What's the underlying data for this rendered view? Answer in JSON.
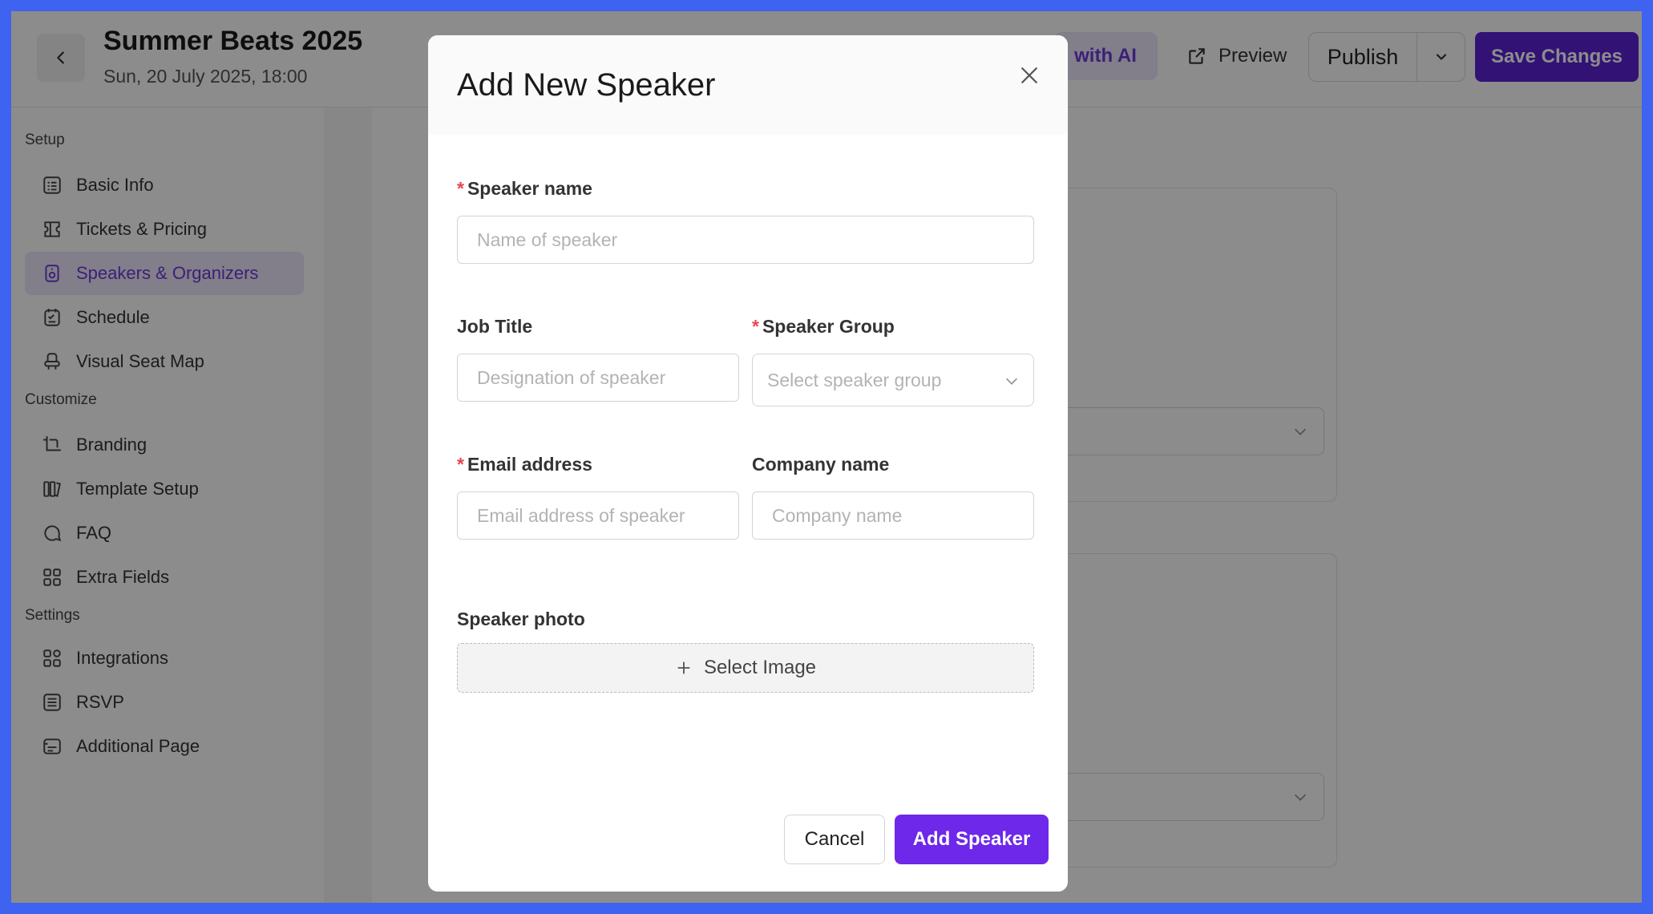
{
  "header": {
    "event_title": "Summer Beats 2025",
    "event_date": "Sun, 20 July 2025, 18:00",
    "ai_button_label": "with AI",
    "preview_label": "Preview",
    "publish_label": "Publish",
    "save_label": "Save Changes"
  },
  "sidebar": {
    "sections": [
      {
        "label": "Setup",
        "items": [
          {
            "label": "Basic Info",
            "icon": "form-icon"
          },
          {
            "label": "Tickets & Pricing",
            "icon": "ticket-icon"
          },
          {
            "label": "Speakers & Organizers",
            "icon": "speaker-icon",
            "active": true
          },
          {
            "label": "Schedule",
            "icon": "schedule-icon"
          },
          {
            "label": "Visual Seat Map",
            "icon": "seat-icon"
          }
        ]
      },
      {
        "label": "Customize",
        "items": [
          {
            "label": "Branding",
            "icon": "crop-icon"
          },
          {
            "label": "Template Setup",
            "icon": "template-icon"
          },
          {
            "label": "FAQ",
            "icon": "chat-icon"
          },
          {
            "label": "Extra Fields",
            "icon": "grid-icon"
          }
        ]
      },
      {
        "label": "Settings",
        "items": [
          {
            "label": "Integrations",
            "icon": "apps-icon"
          },
          {
            "label": "RSVP",
            "icon": "list-icon"
          },
          {
            "label": "Additional Page",
            "icon": "page-icon"
          }
        ]
      }
    ]
  },
  "modal": {
    "title": "Add New Speaker",
    "speaker_name": {
      "label": "Speaker name",
      "placeholder": "Name of speaker",
      "value": ""
    },
    "job_title": {
      "label": "Job Title",
      "placeholder": "Designation of speaker",
      "value": ""
    },
    "speaker_group": {
      "label": "Speaker Group",
      "placeholder": "Select speaker group"
    },
    "email": {
      "label": "Email address",
      "placeholder": "Email address of speaker",
      "value": ""
    },
    "company": {
      "label": "Company name",
      "placeholder": "Company name",
      "value": ""
    },
    "photo": {
      "label": "Speaker photo",
      "button_label": "Select Image"
    },
    "cancel_label": "Cancel",
    "submit_label": "Add Speaker",
    "required_mark": "*"
  },
  "colors": {
    "accent": "#6d28ea",
    "save_button": "#5b21d6",
    "active_nav_bg": "#ede6fb",
    "required": "#e5484d",
    "frame_border": "#3d63f0"
  }
}
